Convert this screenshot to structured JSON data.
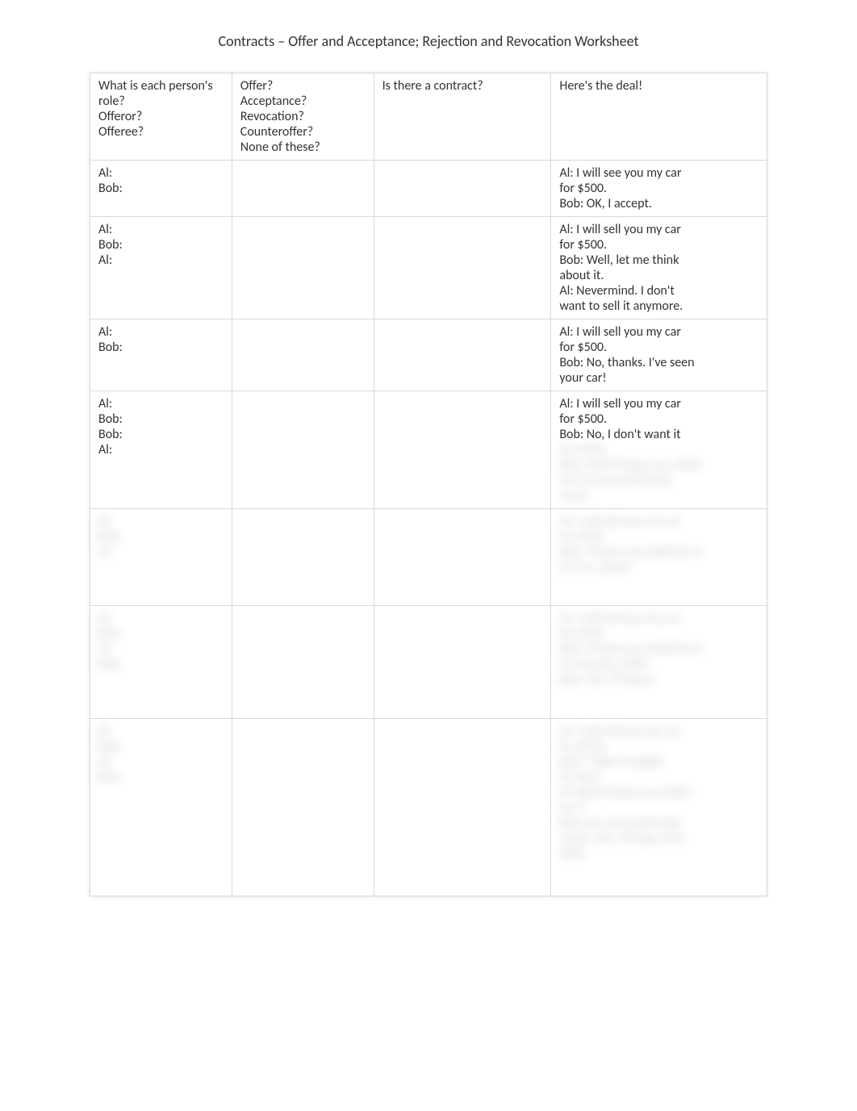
{
  "title": "Contracts – Offer and Acceptance; Rejection and Revocation Worksheet",
  "headers": {
    "col1": {
      "l1": "What is each person's",
      "l2": "role?",
      "l3": "Offeror?",
      "l4": "Offeree?"
    },
    "col2": {
      "l1": "Offer?",
      "l2": "Acceptance?",
      "l3": "Revocation?",
      "l4": "Counteroffer?",
      "l5": "None of these?"
    },
    "col3": "Is there a contract?",
    "col4": "Here's the deal!"
  },
  "rows": [
    {
      "col1": {
        "l1": "Al:",
        "l2": "Bob:"
      },
      "col4": {
        "l1": "Al: I will see you my car",
        "l2": "for $500.",
        "l3": "Bob: OK, I accept."
      }
    },
    {
      "col1": {
        "l1": "Al:",
        "l2": "Bob:",
        "l3": "Al:"
      },
      "col4": {
        "l1": "Al: I will sell you my car",
        "l2": "for $500.",
        "l3": "Bob: Well, let me think",
        "l4": "about it.",
        "l5": "Al: Nevermind. I don't",
        "l6": "want to sell it anymore."
      }
    },
    {
      "col1": {
        "l1": "Al:",
        "l2": "Bob:"
      },
      "col4": {
        "l1": "Al: I will sell you my car",
        "l2": "for $500.",
        "l3": "Bob: No, thanks. I've seen",
        "l4": "your car!"
      }
    },
    {
      "col1": {
        "l1": "Al:",
        "l2": "Bob:",
        "l3": "Bob:",
        "l4": "Al:"
      },
      "col4": {
        "l1": "Al: I will sell you my car",
        "l2": "for $500.",
        "l3": "Bob: No, I don't want it"
      }
    }
  ]
}
